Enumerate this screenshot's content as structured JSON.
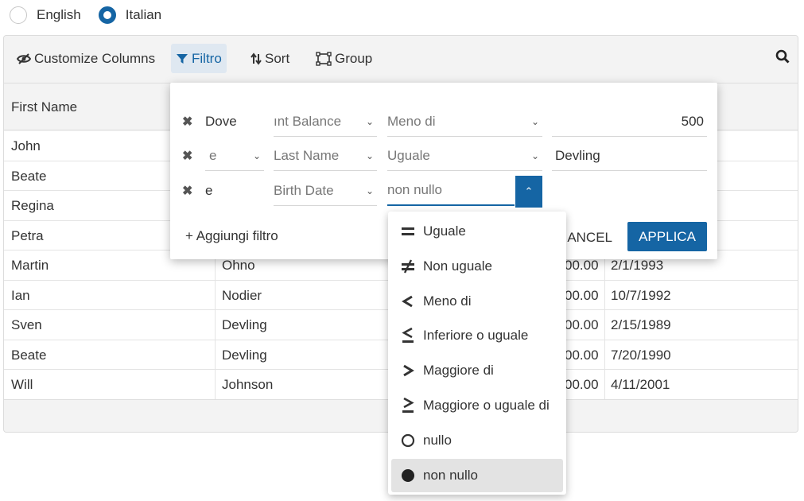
{
  "language": {
    "options": [
      {
        "label": "English",
        "selected": false
      },
      {
        "label": "Italian",
        "selected": true
      }
    ]
  },
  "toolbar": {
    "customize_columns": "Customize Columns",
    "filter": "Filtro",
    "sort": "Sort",
    "group": "Group"
  },
  "columns": [
    "First Name"
  ],
  "rows": [
    {
      "first": "John",
      "last": "",
      "balance": "",
      "date": ""
    },
    {
      "first": "Beate",
      "last": "",
      "balance": "",
      "date": ""
    },
    {
      "first": "Regina",
      "last": "",
      "balance": "",
      "date": ""
    },
    {
      "first": "Petra",
      "last": "",
      "balance": "",
      "date": ""
    },
    {
      "first": "Martin",
      "last": "Ohno",
      "balance": "00.00",
      "date": "2/1/1993"
    },
    {
      "first": "Ian",
      "last": "Nodier",
      "balance": "00.00",
      "date": "10/7/1992"
    },
    {
      "first": "Sven",
      "last": "Devling",
      "balance": "00.00",
      "date": "2/15/1989"
    },
    {
      "first": "Beate",
      "last": "Devling",
      "balance": "00.00",
      "date": "7/20/1990"
    },
    {
      "first": "Will",
      "last": "Johnson",
      "balance": "00.00",
      "date": "4/11/2001"
    }
  ],
  "filter_panel": {
    "rows": [
      {
        "conjunction": "Dove",
        "field": "ınt Balance",
        "operator": "Meno di",
        "value": "500"
      },
      {
        "conjunction": "e",
        "field": "Last Name",
        "operator": "Uguale",
        "value": "Devling"
      },
      {
        "conjunction": "e",
        "field": "Birth Date",
        "operator": "non nullo",
        "value": ""
      }
    ],
    "add_filter": "+ Aggiungi filtro",
    "cancel": "ANCEL",
    "apply": "APPLICA"
  },
  "operator_dropdown": {
    "items": [
      {
        "label": "Uguale",
        "icon": "equals-icon"
      },
      {
        "label": "Non uguale",
        "icon": "not-equal-icon"
      },
      {
        "label": "Meno di",
        "icon": "less-than-icon"
      },
      {
        "label": "Inferiore o uguale",
        "icon": "less-equal-icon"
      },
      {
        "label": "Maggiore di",
        "icon": "greater-than-icon"
      },
      {
        "label": "Maggiore o uguale di",
        "icon": "greater-equal-icon"
      },
      {
        "label": "nullo",
        "icon": "circle-outline-icon"
      },
      {
        "label": "non nullo",
        "icon": "circle-filled-icon"
      }
    ],
    "selected": "non nullo"
  },
  "colors": {
    "accent": "#1565a4"
  }
}
